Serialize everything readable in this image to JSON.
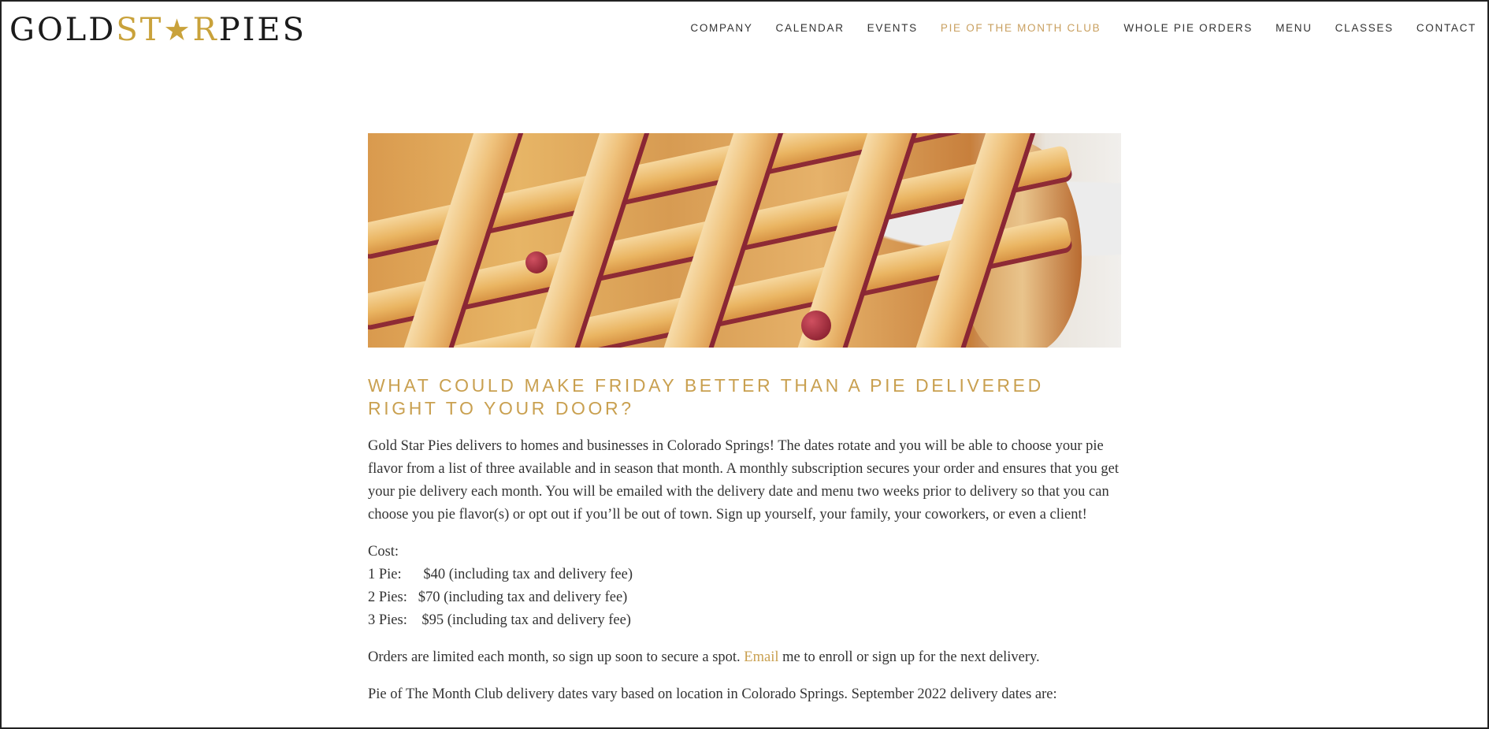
{
  "logo": {
    "part1": "GOLD",
    "part2": "ST",
    "star": "★",
    "part3": "R",
    "part4": "PIES"
  },
  "nav": {
    "items": [
      {
        "label": "COMPANY"
      },
      {
        "label": "CALENDAR"
      },
      {
        "label": "EVENTS"
      },
      {
        "label": "PIE OF THE MONTH CLUB",
        "active": true
      },
      {
        "label": "WHOLE PIE ORDERS"
      },
      {
        "label": "MENU"
      },
      {
        "label": "CLASSES"
      },
      {
        "label": "CONTACT"
      }
    ]
  },
  "main": {
    "headline": "WHAT COULD MAKE FRIDAY BETTER THAN A PIE DELIVERED RIGHT TO YOUR DOOR?",
    "intro": "Gold Star Pies delivers to homes and businesses in Colorado Springs! The dates rotate and you will be able to choose your pie flavor from a list of three available and in season that month. A monthly subscription secures your order and ensures that you get your pie delivery each month. You will be emailed with the delivery date and menu two weeks prior to delivery so that you can choose you pie flavor(s) or opt out if you’ll be out of town. Sign up yourself, your family, your coworkers, or even a client!",
    "cost": {
      "heading": "Cost:",
      "lines": [
        "1 Pie:      $40 (including tax and delivery fee)",
        "2 Pies:   $70 (including tax and delivery fee)",
        "3 Pies:    $95 (including tax and delivery fee)"
      ]
    },
    "orders": {
      "before": "Orders are limited each month, so sign up soon to secure a spot. ",
      "link": "Email",
      "after": " me to enroll or sign up for the next delivery."
    },
    "dates_text": "Pie of The Month Club delivery dates vary based on location in Colorado Springs. September 2022 delivery dates are:"
  },
  "colors": {
    "accent_gold": "#c9a050",
    "logo_gold": "#c9a23b",
    "text": "#333333"
  }
}
